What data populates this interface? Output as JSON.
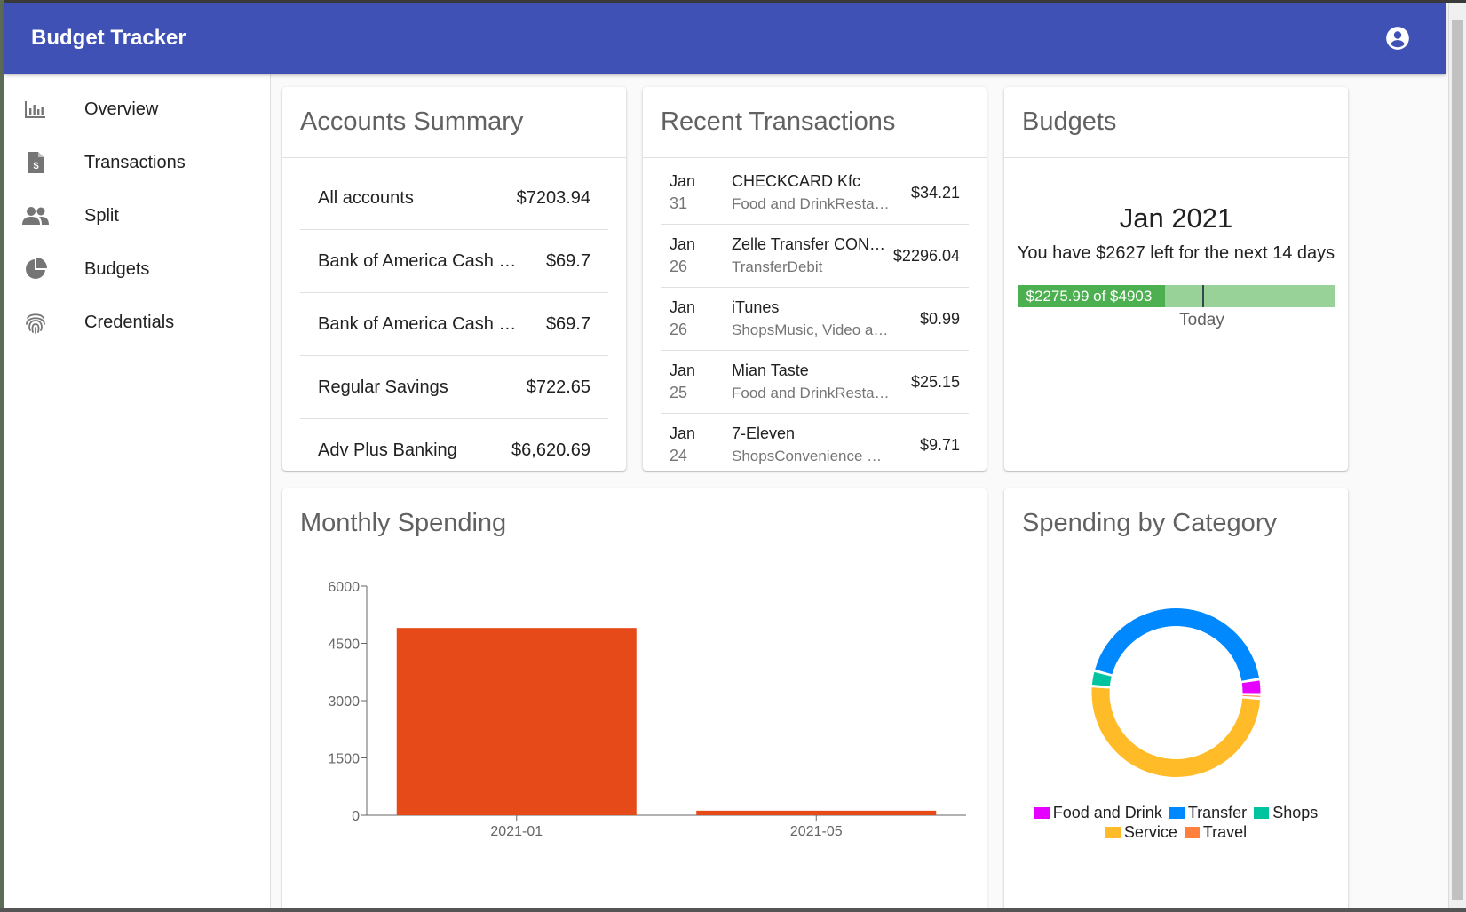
{
  "app": {
    "title": "Budget Tracker",
    "account_icon": "account-circle-icon"
  },
  "sidebar": {
    "items": [
      {
        "label": "Overview",
        "icon": "bar-chart-icon"
      },
      {
        "label": "Transactions",
        "icon": "receipt-icon"
      },
      {
        "label": "Split",
        "icon": "people-icon"
      },
      {
        "label": "Budgets",
        "icon": "pie-chart-icon"
      },
      {
        "label": "Credentials",
        "icon": "fingerprint-icon"
      }
    ]
  },
  "accounts": {
    "title": "Accounts Summary",
    "rows": [
      {
        "name": "All accounts",
        "amount": "$7203.94"
      },
      {
        "name": "Bank of America Cash …",
        "amount": "$69.7"
      },
      {
        "name": "Bank of America Cash …",
        "amount": "$69.7"
      },
      {
        "name": "Regular Savings",
        "amount": "$722.65"
      },
      {
        "name": "Adv Plus Banking",
        "amount": "$6,620.69"
      }
    ]
  },
  "transactions": {
    "title": "Recent Transactions",
    "rows": [
      {
        "month": "Jan",
        "day": "31",
        "name": "CHECKCARD Kfc",
        "category": "Food and DrinkResta…",
        "amount": "$34.21"
      },
      {
        "month": "Jan",
        "day": "26",
        "name": "Zelle Transfer CONF…",
        "category": "TransferDebit",
        "amount": "$2296.04"
      },
      {
        "month": "Jan",
        "day": "26",
        "name": "iTunes",
        "category": "ShopsMusic, Video a…",
        "amount": "$0.99"
      },
      {
        "month": "Jan",
        "day": "25",
        "name": "Mian Taste",
        "category": "Food and DrinkResta…",
        "amount": "$25.15"
      },
      {
        "month": "Jan",
        "day": "24",
        "name": "7-Eleven",
        "category": "ShopsConvenience …",
        "amount": "$9.71"
      }
    ]
  },
  "budgets": {
    "title": "Budgets",
    "month": "Jan 2021",
    "message": "You have $2627 left for the next 14 days",
    "spent_label": "$2275.99 of $4903",
    "spent": 2275.99,
    "total": 4903,
    "today_fraction": 0.58,
    "today_label": "Today",
    "colors": {
      "fill": "#4caf50",
      "track": "#98d298"
    }
  },
  "monthly": {
    "title": "Monthly Spending",
    "chart_data": {
      "type": "bar",
      "categories": [
        "2021-01",
        "2021-05"
      ],
      "values": [
        4903,
        120
      ],
      "ylim": [
        0,
        6000
      ],
      "yticks": [
        0,
        1500,
        3000,
        4500,
        6000
      ],
      "xlabel": "",
      "ylabel": "",
      "color": "#e64a19"
    }
  },
  "category": {
    "title": "Spending by Category",
    "chart_data": {
      "type": "pie",
      "donut": true,
      "legend_position": "bottom",
      "slices": [
        {
          "label": "Food and Drink",
          "value": 59.36,
          "color": "#e600ff"
        },
        {
          "label": "Travel",
          "value": 15,
          "color": "#ff7f3f"
        },
        {
          "label": "Service",
          "value": 1020,
          "color": "#ffbb28"
        },
        {
          "label": "Shops",
          "value": 60,
          "color": "#00c49f"
        },
        {
          "label": "Transfer",
          "value": 880,
          "color": "#0088fe"
        }
      ],
      "legend_order": [
        "Food and Drink",
        "Transfer",
        "Shops",
        "Service",
        "Travel"
      ]
    }
  }
}
